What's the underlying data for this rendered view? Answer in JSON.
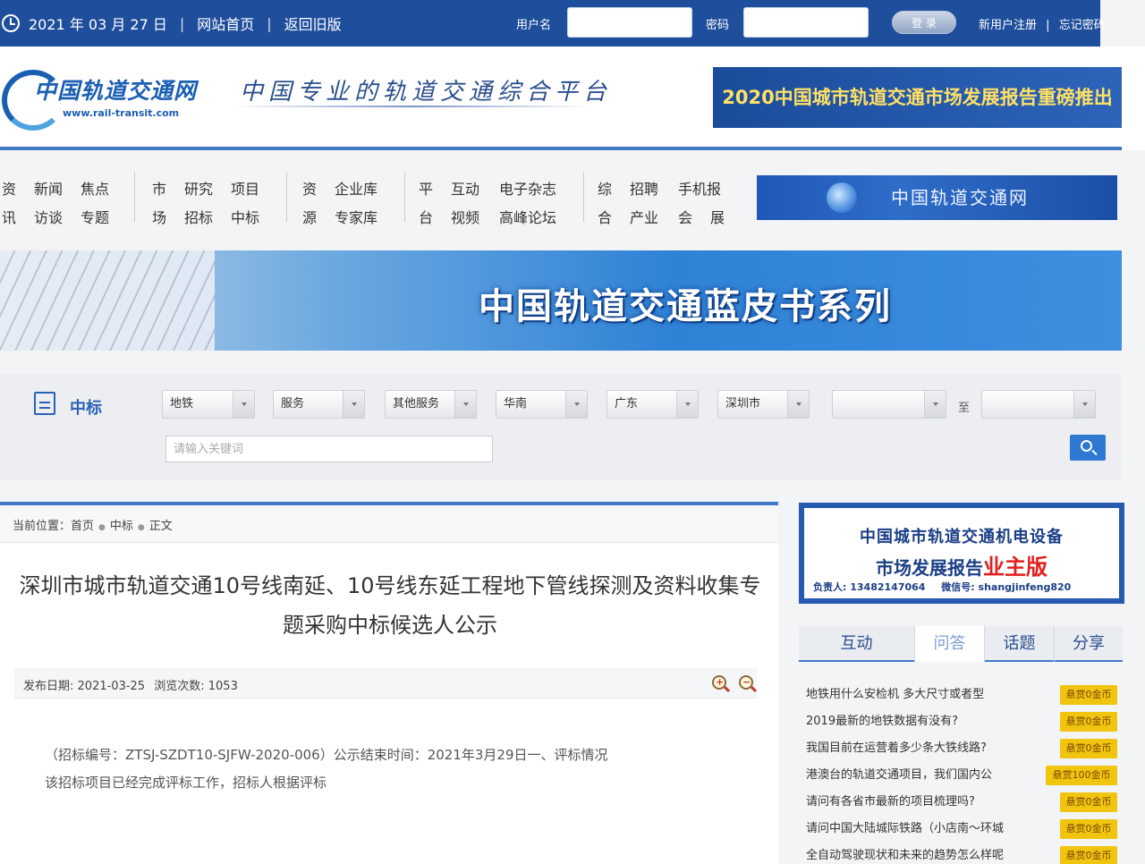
{
  "topbar": {
    "date": "2021 年 03 月 27 日",
    "home_link": "网站首页",
    "old_version_link": "返回旧版",
    "username_label": "用户名",
    "password_label": "密码",
    "login_button": "登 录",
    "register_link": "新用户注册",
    "forgot_link": "忘记密码"
  },
  "header": {
    "logo_name": "中国轨道交通网",
    "logo_url": "www.rail-transit.com",
    "slogan": "中国专业的轨道交通综合平台",
    "ad_text": "2020中国城市轨道交通市场发展报告重磅推出"
  },
  "nav": {
    "groups": [
      {
        "row1": [
          "资",
          "新闻",
          "焦点"
        ],
        "row2": [
          "讯",
          "访谈",
          "专题"
        ]
      },
      {
        "row1": [
          "市",
          "研究",
          "项目"
        ],
        "row2": [
          "场",
          "招标",
          "中标"
        ]
      },
      {
        "row1": [
          "资",
          "企业库"
        ],
        "row2": [
          "源",
          "专家库"
        ]
      },
      {
        "row1": [
          "平",
          "互动",
          "电子杂志"
        ],
        "row2": [
          "台",
          "视频",
          "高峰论坛"
        ]
      },
      {
        "row1": [
          "综",
          "招聘",
          "手机报"
        ],
        "row2": [
          "合",
          "产业",
          "会",
          "展"
        ]
      }
    ],
    "ad_text": "中国轨道交通网"
  },
  "banner": {
    "title": "中国轨道交通蓝皮书系列"
  },
  "filter": {
    "section_title": "中标",
    "selects": [
      "地铁",
      "服务",
      "其他服务",
      "华南",
      "广东",
      "深圳市",
      "",
      ""
    ],
    "to_label": "至",
    "keyword_placeholder": "请输入关键词"
  },
  "article": {
    "breadcrumb": [
      "当前位置：首页",
      "中标",
      "正文"
    ],
    "title": "深圳市城市轨道交通10号线南延、10号线东延工程地下管线探测及资料收集专题采购中标候选人公示",
    "date_label": "发布日期:",
    "date": "2021-03-25",
    "views_label": "浏览次数:",
    "views": "1053",
    "body_line1": "（招标编号：ZTSJ-SZDT10-SJFW-2020-006）公示结束时间：2021年3月29日一、评标情况",
    "body_line2": "该招标项目已经完成评标工作，招标人根据评标"
  },
  "sidebar": {
    "ad": {
      "line1": "中国城市轨道交通机电设备",
      "line2": "市场发展报告",
      "line2_highlight": "业主版",
      "phone_label": "负责人:",
      "phone": "13482147064",
      "wechat_label": "微信号:",
      "wechat": "shangjinfeng820"
    },
    "tabs": [
      "互动",
      "问答",
      "话题",
      "分享"
    ],
    "questions": [
      {
        "text": "地铁用什么安检机 多大尺寸或者型",
        "badge": "悬赏0金币"
      },
      {
        "text": "2019最新的地铁数据有没有?",
        "badge": "悬赏0金币"
      },
      {
        "text": "我国目前在运营着多少条大铁线路?",
        "badge": "悬赏0金币"
      },
      {
        "text": "港澳台的轨道交通项目，我们国内公",
        "badge": "悬赏100金币"
      },
      {
        "text": "请问有各省市最新的项目梳理吗?",
        "badge": "悬赏0金币"
      },
      {
        "text": "请问中国大陆城际铁路（小店南～环城",
        "badge": "悬赏0金币"
      },
      {
        "text": "全自动驾驶现状和未来的趋势怎么样呢",
        "badge": "悬赏0金币"
      }
    ]
  }
}
